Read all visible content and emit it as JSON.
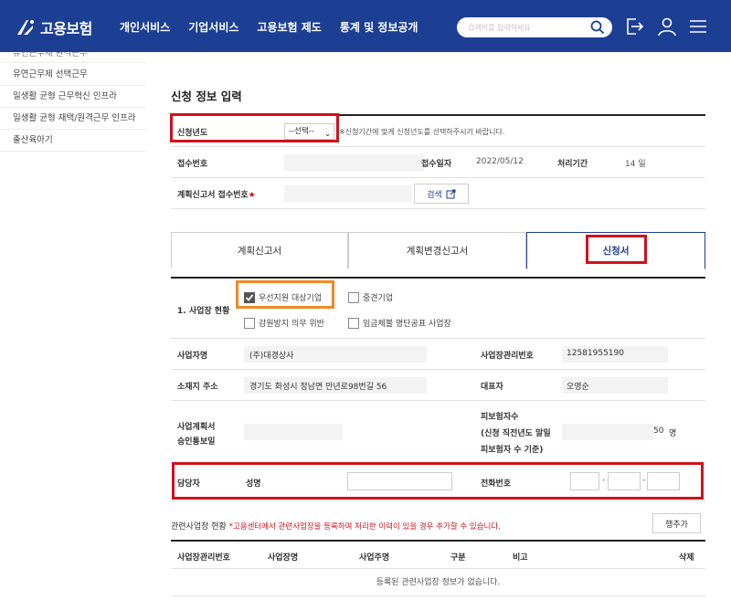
{
  "header": {
    "logo_text": "고용보험",
    "nav": [
      "개인서비스",
      "기업서비스",
      "고용보험 제도",
      "통계 및 정보공개"
    ],
    "search_placeholder": "검색어를 입력하세요"
  },
  "sidebar": {
    "items": [
      "유연근무제 원격근무",
      "유연근무제 선택근무",
      "일생활 균형 근무혁신 인프라",
      "일생활 균형 재택/원격근무 인프라",
      "출산육아기"
    ]
  },
  "section_title": "신청 정보 입력",
  "info": {
    "year_label": "신청년도",
    "year_select": "--선택--",
    "year_hint": "※신청기간에 맞게 신청년도를 선택하주시기 바랍니다.",
    "receipt_no_label": "접수번호",
    "receipt_date_label": "접수일자",
    "receipt_date": "2022/05/12",
    "period_label": "처리기간",
    "period_value": "14 일",
    "plan_no_label": "계획신고서 접수번호",
    "required_mark": "★",
    "search_button": "검색"
  },
  "tabs": [
    "계획신고서",
    "계획변경신고서",
    "신청서"
  ],
  "application": {
    "status_label": "1. 사업장 현황",
    "checkboxes": [
      {
        "label": "우선지원 대상기업",
        "checked": true
      },
      {
        "label": "중견기업",
        "checked": false
      },
      {
        "label": "감원방지 의무 위반",
        "checked": false
      },
      {
        "label": "임금체불 명단공표 사업장",
        "checked": false
      }
    ],
    "company_name_label": "사업자명",
    "company_name": "(주)대경상사",
    "mgmt_no_label": "사업장관리번호",
    "mgmt_no": "12581955190",
    "address_label": "소재지 주소",
    "address": "경기도 화성시 정남면 만년로98번길 56",
    "rep_label": "대표자",
    "rep_name": "오영순",
    "approval_label_1": "사업계획서",
    "approval_label_2": "승인통보일",
    "insured_label_1": "피보험자수",
    "insured_label_2": "(신청 직전년도 말일",
    "insured_label_3": "피보험자 수 기준)",
    "insured_count": "50",
    "insured_unit": "명",
    "manager_label": "담당자",
    "name_label": "성명",
    "phone_label": "전화번호",
    "phone_sep": "-"
  },
  "related": {
    "title": "관련사업장 현황",
    "warning": "*고용센터에서 관련사업장을 등록하여 처리한 이력이 있을 경우 추가할 수 있습니다.",
    "add_button": "행추가",
    "columns": [
      "사업장관리번호",
      "사업장명",
      "사업주명",
      "구분",
      "비고",
      "삭제"
    ],
    "empty_message": "등록된 관련사업장 정보가 없습니다."
  },
  "colors": {
    "brand": "#1c3f94",
    "highlight_red": "#d0111c",
    "highlight_orange": "#f08a24"
  }
}
